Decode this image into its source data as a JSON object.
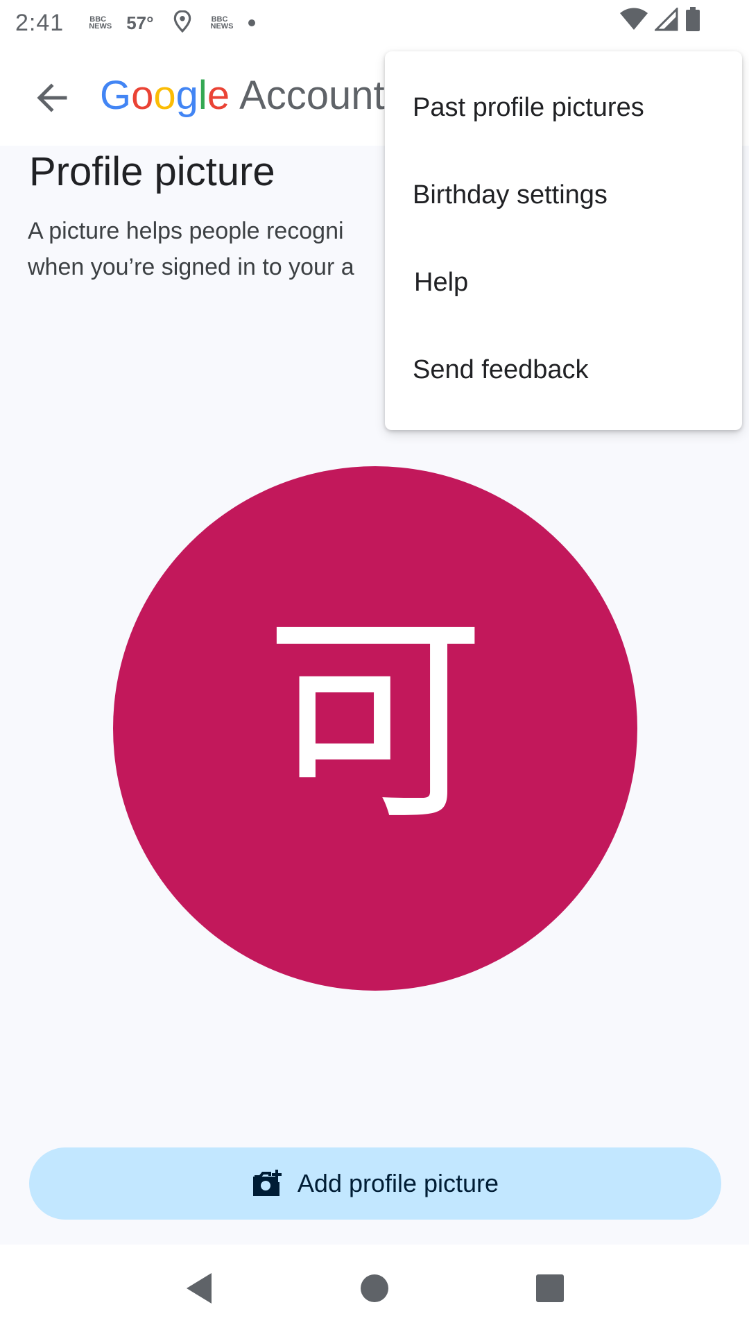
{
  "status_bar": {
    "time": "2:41",
    "temperature": "57°",
    "news_label": "BBC NEWS"
  },
  "app_bar": {
    "brand_letters": [
      "G",
      "o",
      "o",
      "g",
      "l",
      "e"
    ],
    "brand_suffix": "Account"
  },
  "page": {
    "title": "Profile picture",
    "description_line1": "A picture helps people recogni",
    "description_line2": "when you’re signed in to your a"
  },
  "avatar": {
    "character": "可",
    "background_color": "#c2185b"
  },
  "menu": {
    "items": [
      {
        "label": "Past profile pictures"
      },
      {
        "label": "Birthday settings"
      },
      {
        "label": "Help"
      },
      {
        "label": "Send feedback"
      }
    ]
  },
  "add_button": {
    "label": "Add profile picture",
    "icon": "add-photo-icon",
    "color": "#c2e7ff"
  }
}
